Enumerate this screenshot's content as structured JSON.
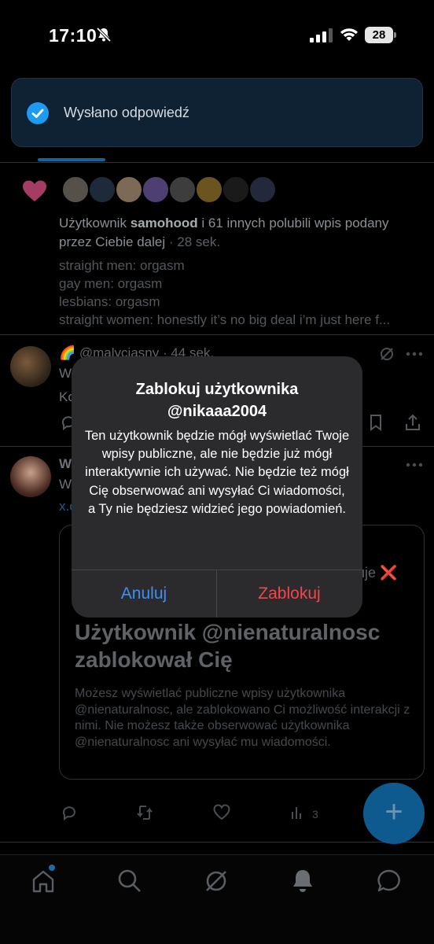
{
  "status_bar": {
    "time": "17:10",
    "battery": "28"
  },
  "toast": {
    "text": "Wysłano odpowiedź"
  },
  "notification": {
    "prefix": "Użytkownik ",
    "user": "samohood",
    "rest": " i 61 innych polubili wpis podany przez Ciebie dalej",
    "time": " · 28 sek.",
    "quote_lines": [
      "straight men: orgasm",
      "gay men: orgasm",
      "lesbians: orgasm",
      "straight women: honestly it’s no big deal i’m just here f..."
    ]
  },
  "post1": {
    "header": "🌈 @malyciasny · 44 sek.",
    "line2": "W",
    "line3": "Ko"
  },
  "post2": {
    "header": "W",
    "line2": "W",
    "line3": "x.c",
    "card_side": "uje",
    "card_side_mark": "❌",
    "card_title": "Użytkownik @nienaturalnosc zablokował Cię",
    "card_body": "Możesz wyświetlać publiczne wpisy użytkownika @nienaturalnosc, ale zablokowano Ci możliwość interakcji z nimi. Nie możesz także obserwować użytkownika @nienaturalnosc ani wysyłać mu wiadomości.",
    "views": "3"
  },
  "fab": {
    "label": "+"
  },
  "alert": {
    "title_line1": "Zablokuj użytkownika",
    "title_line2": "@nikaaa2004",
    "message": "Ten użytkownik będzie mógł wyświetlać Twoje wpisy publiczne, ale nie będzie już mógł interaktywnie ich używać. Nie będzie też mógł Cię obserwować ani wysyłać Ci wiadomości, a Ty nie będziesz widzieć jego powiadomień.",
    "cancel_label": "Anuluj",
    "confirm_label": "Zablokuj"
  },
  "colors": {
    "accent": "#1d9bf0",
    "alert_bg": "#2b2b2d",
    "cancel": "#3e8ef7",
    "destructive": "#f1464a",
    "like_pink": "#d6457a"
  },
  "tabbar": {
    "items": [
      "home-icon",
      "search-icon",
      "grok-icon",
      "notifications-icon",
      "messages-icon"
    ]
  }
}
